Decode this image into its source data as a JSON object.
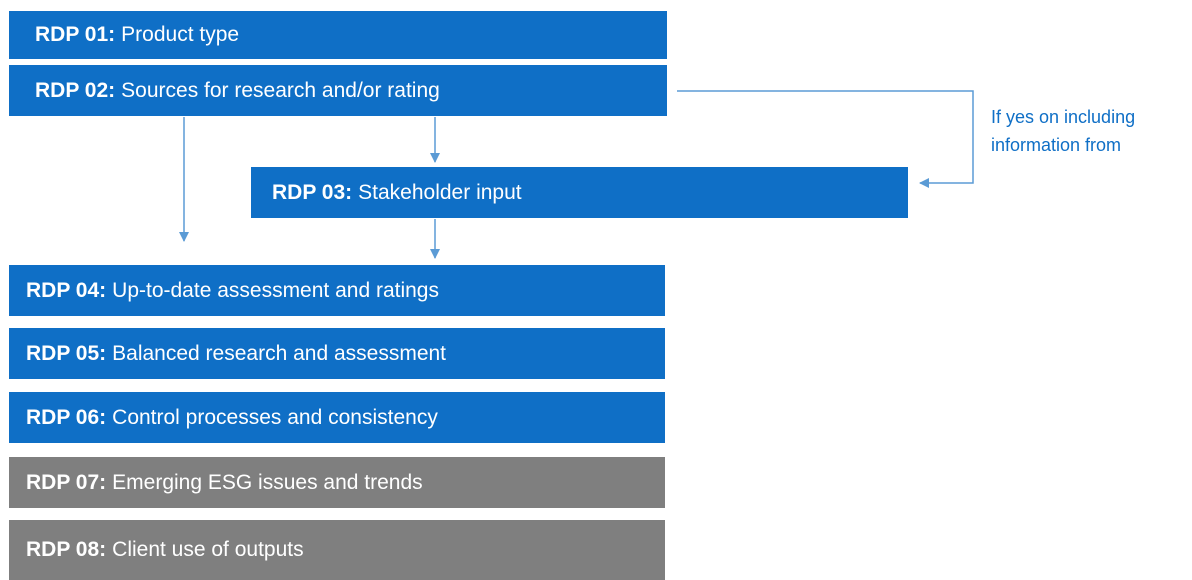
{
  "colors": {
    "blue": "#0f6fc6",
    "grey": "#7f7f7f",
    "arrow": "#5b9bd5"
  },
  "steps": [
    {
      "code": "RDP 01:",
      "label": "Product type",
      "color": "blue"
    },
    {
      "code": "RDP 02:",
      "label": "Sources for research and/or rating",
      "color": "blue"
    },
    {
      "code": "RDP 03:",
      "label": "Stakeholder input",
      "color": "blue"
    },
    {
      "code": "RDP 04:",
      "label": "Up-to-date assessment and ratings",
      "color": "blue"
    },
    {
      "code": "RDP 05:",
      "label": "Balanced research and assessment",
      "color": "blue"
    },
    {
      "code": "RDP 06:",
      "label": "Control processes and consistency",
      "color": "blue"
    },
    {
      "code": "RDP 07:",
      "label": "Emerging ESG issues and trends",
      "color": "grey"
    },
    {
      "code": "RDP 08:",
      "label": "Client use of outputs",
      "color": "grey"
    }
  ],
  "note": {
    "line1": "If yes on including",
    "line2": "information from"
  }
}
